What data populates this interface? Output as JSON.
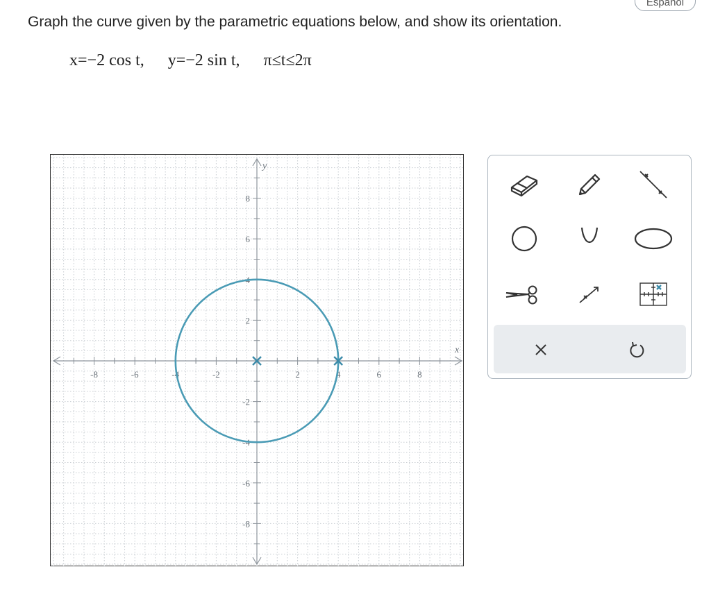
{
  "header": {
    "language_button": "Español"
  },
  "problem": {
    "instruction": "Graph the curve given by the parametric equations below, and show its orientation.",
    "eq_x": "x=−2 cos t,",
    "eq_y": "y=−2 sin t,",
    "eq_range": "π≤t≤2π"
  },
  "graph": {
    "x_axis_label": "x",
    "y_axis_label": "y",
    "x_range": [
      -10,
      10
    ],
    "y_range": [
      -10,
      10
    ],
    "x_ticks": [
      -8,
      -6,
      -4,
      -2,
      2,
      4,
      6,
      8
    ],
    "y_ticks": [
      -8,
      -6,
      -4,
      -2,
      2,
      4,
      6,
      8
    ],
    "x_tick_labels": [
      "-8",
      "-6",
      "-4",
      "-2",
      "2",
      "4",
      "6",
      "8"
    ],
    "y_tick_labels": [
      "8",
      "6",
      "4",
      "2",
      "-2",
      "-4",
      "-6",
      "-8"
    ],
    "circle": {
      "center": [
        0,
        0
      ],
      "radius": 4,
      "color": "#4a9bb5"
    },
    "points": [
      {
        "x": 0,
        "y": 0
      },
      {
        "x": 4,
        "y": 0
      }
    ],
    "point_color": "#3a8aa8"
  },
  "toolbar": {
    "tools": [
      "eraser-icon",
      "pencil-icon",
      "line-segment-icon",
      "circle-icon",
      "parabola-icon",
      "ellipse-icon",
      "scissors-icon",
      "ray-icon",
      "point-grid-icon"
    ],
    "actions": [
      "clear-icon",
      "undo-icon"
    ]
  }
}
